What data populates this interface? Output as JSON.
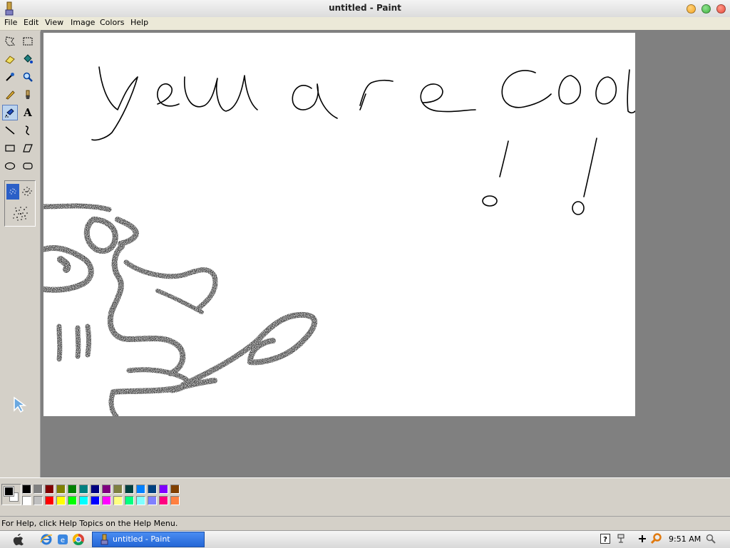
{
  "window": {
    "title": "untitled - Paint",
    "controls": [
      {
        "name": "minimize",
        "color": "#f5a623"
      },
      {
        "name": "maximize",
        "color": "#3fb33f"
      },
      {
        "name": "close",
        "color": "#e8483a"
      }
    ]
  },
  "menu": {
    "items": [
      "File",
      "Edit",
      "View",
      "Image",
      "Colors",
      "Help"
    ]
  },
  "toolbox": {
    "tools": [
      {
        "name": "free-form-select-icon"
      },
      {
        "name": "rectangle-select-icon"
      },
      {
        "name": "eraser-icon"
      },
      {
        "name": "fill-bucket-icon"
      },
      {
        "name": "color-picker-icon"
      },
      {
        "name": "magnifier-icon"
      },
      {
        "name": "pencil-icon"
      },
      {
        "name": "brush-icon"
      },
      {
        "name": "airbrush-icon",
        "selected": true
      },
      {
        "name": "text-icon",
        "glyph": "A"
      },
      {
        "name": "line-icon"
      },
      {
        "name": "curve-icon"
      },
      {
        "name": "rectangle-icon"
      },
      {
        "name": "polygon-icon"
      },
      {
        "name": "ellipse-icon"
      },
      {
        "name": "rounded-rectangle-icon"
      }
    ],
    "airbrush_sizes": [
      "small",
      "medium",
      "large"
    ],
    "selected_airbrush_size": "small"
  },
  "canvas": {
    "background": "#ffffff",
    "drawing_description_text": "you are cool!!"
  },
  "palette": {
    "foreground": "#000000",
    "background": "#ffffff",
    "colors": [
      "#000000",
      "#808080",
      "#800000",
      "#808000",
      "#008000",
      "#008080",
      "#000080",
      "#800080",
      "#808040",
      "#004040",
      "#0080ff",
      "#004080",
      "#8000ff",
      "#804000",
      "#ffffff",
      "#c0c0c0",
      "#ff0000",
      "#ffff00",
      "#00ff00",
      "#00ffff",
      "#0000ff",
      "#ff00ff",
      "#ffff80",
      "#00ff80",
      "#80ffff",
      "#8080ff",
      "#ff0080",
      "#ff8040"
    ]
  },
  "status": {
    "text": "For Help, click Help Topics on the Help Menu."
  },
  "taskbar": {
    "task_label": "untitled - Paint",
    "clock": "9:51 AM",
    "launchers": [
      "apple-icon",
      "ie-icon",
      "explorer-icon",
      "chrome-icon"
    ],
    "tray": [
      "help-icon",
      "network-icon",
      "plus-icon",
      "search-icon"
    ]
  }
}
